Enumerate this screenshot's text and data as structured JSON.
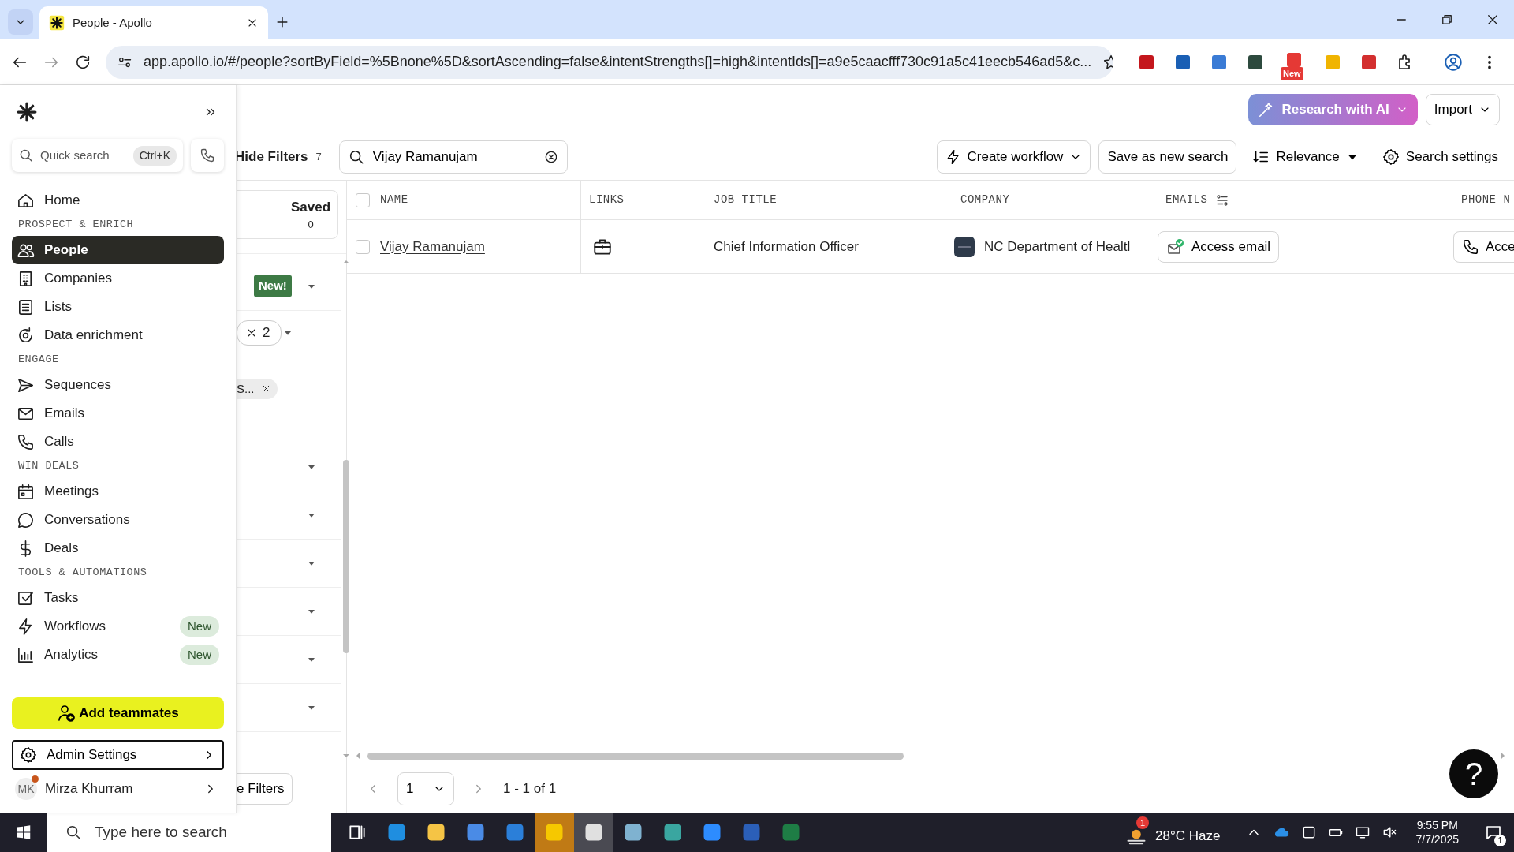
{
  "browser": {
    "tab_title": "People - Apollo",
    "url": "app.apollo.io/#/people?sortByField=%5Bnone%5D&sortAscending=false&intentStrengths[]=high&intentIds[]=a9e5caacfff730c91a5c41eecb546ad5&c...",
    "extension_badge": "New"
  },
  "sidebar": {
    "quick_search": {
      "placeholder": "Quick search",
      "shortcut": "Ctrl+K"
    },
    "nav": [
      {
        "kind": "item",
        "label": "Home",
        "selected": false
      },
      {
        "kind": "heading",
        "label": "PROSPECT & ENRICH"
      },
      {
        "kind": "item",
        "label": "People",
        "selected": true
      },
      {
        "kind": "item",
        "label": "Companies",
        "selected": false
      },
      {
        "kind": "item",
        "label": "Lists",
        "selected": false
      },
      {
        "kind": "item",
        "label": "Data enrichment",
        "selected": false
      },
      {
        "kind": "heading",
        "label": "ENGAGE"
      },
      {
        "kind": "item",
        "label": "Sequences",
        "selected": false
      },
      {
        "kind": "item",
        "label": "Emails",
        "selected": false
      },
      {
        "kind": "item",
        "label": "Calls",
        "selected": false
      },
      {
        "kind": "heading",
        "label": "WIN DEALS"
      },
      {
        "kind": "item",
        "label": "Meetings",
        "selected": false
      },
      {
        "kind": "item",
        "label": "Conversations",
        "selected": false
      },
      {
        "kind": "item",
        "label": "Deals",
        "selected": false
      },
      {
        "kind": "heading",
        "label": "TOOLS & AUTOMATIONS"
      },
      {
        "kind": "item",
        "label": "Tasks",
        "selected": false
      },
      {
        "kind": "item",
        "label": "Workflows",
        "selected": false,
        "badge": "New"
      },
      {
        "kind": "item",
        "label": "Analytics",
        "selected": false,
        "badge": "New"
      }
    ],
    "add_teammates": "Add teammates",
    "admin_settings": "Admin Settings",
    "user": {
      "initials": "MK",
      "name": "Mirza Khurram",
      "notification_dot": true
    }
  },
  "filters": {
    "hide_label": "Hide Filters",
    "count": "7",
    "saved": {
      "label": "Saved",
      "count": "0"
    },
    "rows": [
      {
        "kind": "badge",
        "badge": "New!"
      },
      {
        "kind": "chips",
        "chip_count": "2",
        "tag": "S..."
      },
      {
        "kind": "plain"
      },
      {
        "kind": "plain"
      },
      {
        "kind": "plain"
      },
      {
        "kind": "plain"
      },
      {
        "kind": "plain"
      },
      {
        "kind": "plain"
      }
    ],
    "footer_button": "e Filters"
  },
  "header": {
    "research_button": "Research with AI",
    "import_button": "Import"
  },
  "toolbar": {
    "search": {
      "value": "Vijay Ramanujam"
    },
    "create_workflow": "Create workflow",
    "save_search": "Save as new search",
    "sort": "Relevance",
    "settings": "Search settings"
  },
  "table": {
    "select_all": false,
    "columns": [
      {
        "label": "NAME"
      },
      {
        "label": "LINKS"
      },
      {
        "label": "JOB TITLE"
      },
      {
        "label": "COMPANY"
      },
      {
        "label": "EMAILS"
      },
      {
        "label": "PHONE N"
      }
    ],
    "rows": [
      {
        "checked": false,
        "name": "Vijay Ramanujam",
        "job_title": "Chief Information Officer",
        "company": "NC Department of Healtl",
        "email_action": "Access email",
        "phone_action": "Acce"
      }
    ]
  },
  "pagination": {
    "page": "1",
    "range": "1 - 1 of 1"
  },
  "help": "?",
  "taskbar": {
    "search_placeholder": "Type here to search",
    "weather": "28°C Haze",
    "weather_badge": "1",
    "time": "9:55 PM",
    "date": "7/7/2025",
    "notification_count": "1"
  }
}
